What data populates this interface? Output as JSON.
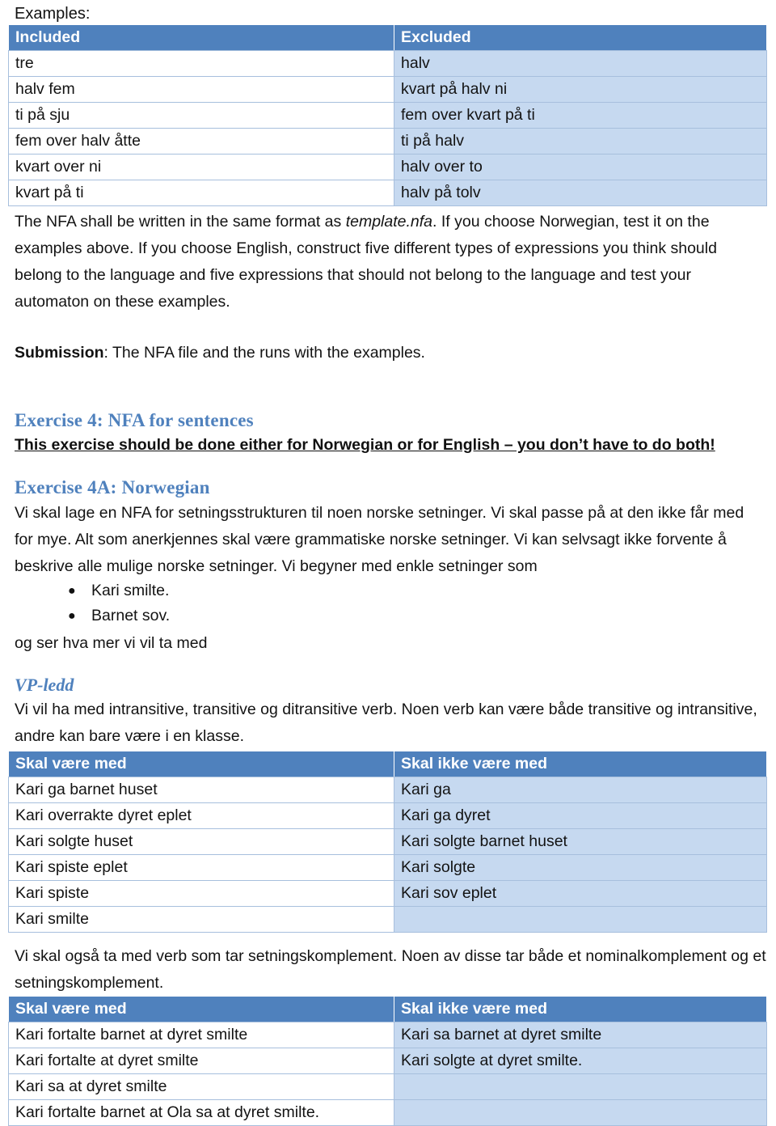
{
  "document": {
    "lead_label": "Examples:"
  },
  "table_examples": {
    "headers": [
      "Included",
      "Excluded"
    ],
    "rows": [
      [
        "tre",
        "halv"
      ],
      [
        "halv fem",
        "kvart på halv ni"
      ],
      [
        "ti på sju",
        "fem over kvart på ti"
      ],
      [
        "fem over halv åtte",
        "ti på halv"
      ],
      [
        "kvart over ni",
        "halv over to"
      ],
      [
        "kvart på ti",
        "halv på tolv"
      ]
    ]
  },
  "paragraph_nfa": {
    "part1": "The NFA shall be written in the same format as ",
    "italic1": "template.nfa",
    "part2": ". If you choose Norwegian, test it on the examples above. If you choose English, construct five different types of expressions you think should belong to the language and five expressions  that should not belong to the language and test your automaton on these examples."
  },
  "submission": {
    "label": "Submission",
    "text": ": The NFA file and the runs with the examples."
  },
  "exercise4": {
    "heading": "Exercise 4:  NFA for sentences",
    "note": "This exercise should be done either for Norwegian or for English – you don’t have to do both!"
  },
  "exercise4a": {
    "heading": "Exercise 4A:  Norwegian",
    "paragraph": "Vi skal lage en NFA for setningsstrukturen til noen norske setninger. Vi skal passe på at den ikke får med for mye. Alt som anerkjennes skal være grammatiske norske setninger. Vi kan selvsagt ikke forvente å beskrive alle mulige norske setninger. Vi begyner med enkle setninger som",
    "bullets": [
      "Kari smilte.",
      "Barnet sov."
    ],
    "after_bullets": "og ser hva mer vi vil ta med"
  },
  "vp_ledd": {
    "heading": "VP-ledd",
    "paragraph": "Vi vil ha med intransitive, transitive og ditransitive verb. Noen verb kan være både transitive og intransitive, andre kan bare være i en klasse."
  },
  "table_vp": {
    "headers": [
      "Skal være med",
      "Skal ikke være med"
    ],
    "rows": [
      [
        "Kari ga barnet huset",
        "Kari ga"
      ],
      [
        "Kari overrakte dyret eplet",
        "Kari ga dyret"
      ],
      [
        "Kari solgte huset",
        "Kari solgte barnet huset"
      ],
      [
        "Kari spiste eplet",
        "Kari solgte"
      ],
      [
        "Kari spiste",
        "Kari sov eplet"
      ],
      [
        "Kari smilte",
        ""
      ]
    ]
  },
  "paragraph_setningskomplement": {
    "text": "Vi skal også ta med verb som tar setningskomplement. Noen av disse tar både et nominalkomplement og et setningskomplement."
  },
  "table_setning": {
    "headers": [
      "Skal være med",
      "Skal ikke være med"
    ],
    "rows": [
      [
        "Kari fortalte barnet at dyret smilte",
        "Kari sa barnet at dyret smilte"
      ],
      [
        "Kari fortalte at dyret smilte",
        "Kari solgte at dyret smilte."
      ],
      [
        "Kari sa at dyret smilte",
        ""
      ],
      [
        "Kari fortalte barnet at Ola sa at dyret smilte.",
        ""
      ]
    ]
  },
  "colors": {
    "header_blue": "#4F81BD",
    "shade_blue": "#C6D9F0",
    "border_blue": "#A7BFDD",
    "heading_blue": "#4F81BD"
  }
}
